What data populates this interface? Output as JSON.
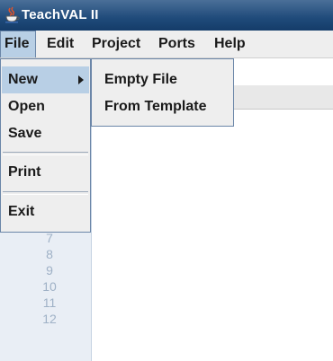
{
  "window": {
    "title": "TeachVAL II",
    "icon": "java-cup-icon"
  },
  "menubar": {
    "items": [
      {
        "label": "File",
        "active": true
      },
      {
        "label": "Edit"
      },
      {
        "label": "Project"
      },
      {
        "label": "Ports"
      },
      {
        "label": "Help"
      }
    ]
  },
  "file_menu": {
    "items": [
      {
        "label": "New",
        "has_submenu": true,
        "highlighted": true
      },
      {
        "label": "Open"
      },
      {
        "label": "Save"
      },
      {
        "label": "Print"
      },
      {
        "label": "Exit"
      }
    ]
  },
  "new_submenu": {
    "items": [
      {
        "label": "Empty File"
      },
      {
        "label": "From Template"
      }
    ]
  },
  "editor": {
    "line_numbers": [
      "7",
      "8",
      "9",
      "10",
      "11",
      "12"
    ]
  },
  "colors": {
    "titlebar": "#1f4a7a",
    "menu_highlight": "#b8cfe5",
    "menu_background": "#eeeeee",
    "gutter_text": "#9fb1c6"
  }
}
